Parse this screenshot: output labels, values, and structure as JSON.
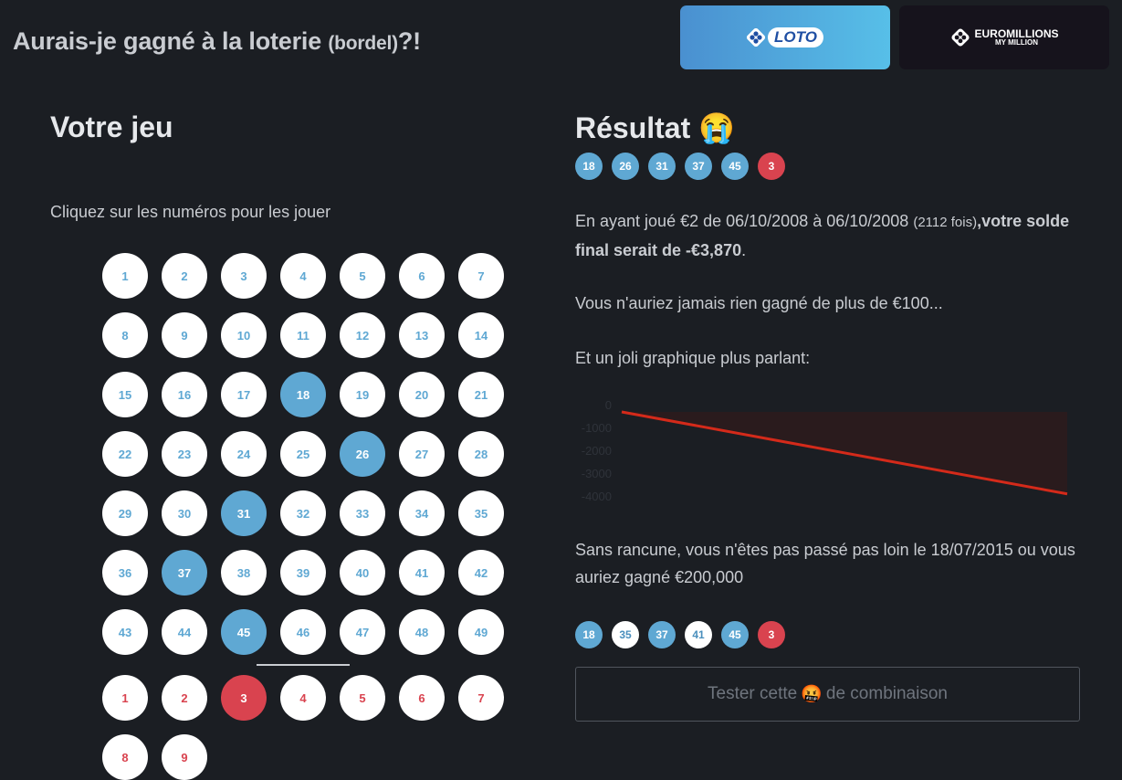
{
  "header": {
    "title_main": "Aurais-je gagné à la loterie ",
    "title_small": "(bordel)",
    "title_end": "?!",
    "games": [
      {
        "id": "loto",
        "logo_text": "LOTO",
        "active": true
      },
      {
        "id": "euromillions",
        "logo_line1": "EUROMILLIONS",
        "logo_line2": "MY MILLION",
        "active": false
      }
    ]
  },
  "left": {
    "title": "Votre jeu",
    "instructions": "Cliquez sur les numéros pour les jouer",
    "numbers_max": 49,
    "numbers_selected": [
      18,
      26,
      31,
      37,
      45
    ],
    "stars_max": 9,
    "stars_selected": [
      3
    ]
  },
  "right": {
    "title": "Résultat",
    "emoji": "😭",
    "drawn": [
      {
        "n": "18",
        "style": "blue"
      },
      {
        "n": "26",
        "style": "blue"
      },
      {
        "n": "31",
        "style": "blue"
      },
      {
        "n": "37",
        "style": "blue"
      },
      {
        "n": "45",
        "style": "blue"
      },
      {
        "n": "3",
        "style": "red"
      }
    ],
    "summary": {
      "p1": "En ayant joué €2 de 06/10/2008 à 06/10/2008 ",
      "count": "(2112 fois)",
      "comma": ",",
      "bold": "votre solde final serait de -€3,870",
      "end": "."
    },
    "max_win": "Vous n'auriez jamais rien gagné de plus de €100...",
    "chart_intro": "Et un joli graphique plus parlant:",
    "near_miss": "Sans rancune, vous n'êtes pas passé pas loin le 18/07/2015 ou vous auriez gagné €200,000",
    "near_miss_balls": [
      {
        "n": "18",
        "style": "blue"
      },
      {
        "n": "35",
        "style": "white"
      },
      {
        "n": "37",
        "style": "blue"
      },
      {
        "n": "41",
        "style": "white"
      },
      {
        "n": "45",
        "style": "blue"
      },
      {
        "n": "3",
        "style": "red"
      }
    ],
    "test_button": {
      "before": "Tester cette ",
      "emoji": "🤬",
      "after": " de combinaison"
    }
  },
  "chart_data": {
    "type": "area",
    "y_ticks": [
      "0",
      "-1000",
      "-2000",
      "-3000",
      "-4000"
    ],
    "ylim": [
      -4000,
      0
    ],
    "x_count": 2112,
    "values": [
      -280,
      -3870
    ],
    "colors": {
      "line": "#d42a1a",
      "fill": "#2a1b1d"
    }
  },
  "colors": {
    "background": "#1b1e23",
    "blue_ball": "#5fa8d3",
    "red_ball": "#d9434f"
  }
}
